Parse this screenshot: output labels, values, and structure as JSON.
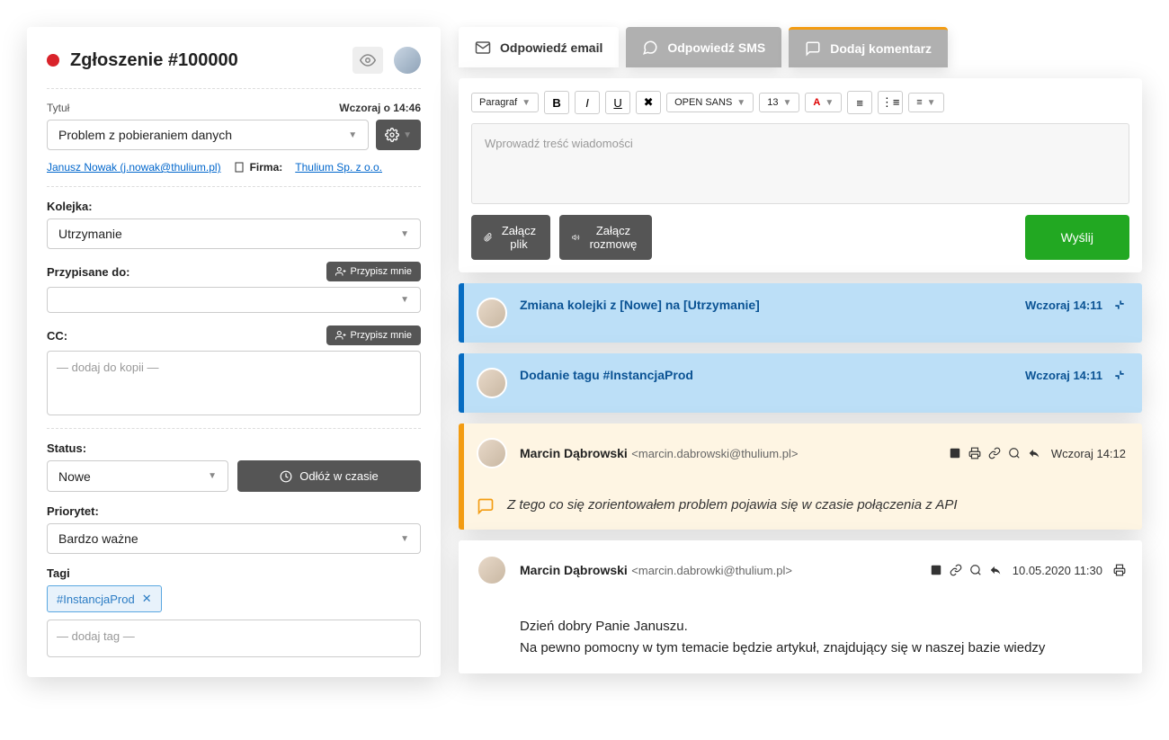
{
  "ticket": {
    "heading": "Zgłoszenie #100000",
    "title_label": "Tytuł",
    "timestamp": "Wczoraj o 14:46",
    "title_value": "Problem z pobieraniem danych",
    "contact_name": "Janusz Nowak (j.nowak@thulium.pl)",
    "company_label": "Firma:",
    "company_value": "Thulium Sp. z o.o.",
    "queue_label": "Kolejka:",
    "queue_value": "Utrzymanie",
    "assigned_label": "Przypisane do:",
    "assign_me": "Przypisz mnie",
    "cc_label": "CC:",
    "cc_placeholder": "— dodaj do kopii —",
    "status_label": "Status:",
    "status_value": "Nowe",
    "postpone": "Odłóż w czasie",
    "priority_label": "Priorytet:",
    "priority_value": "Bardzo ważne",
    "tags_label": "Tagi",
    "tag_value": "#InstancjaProd",
    "tag_placeholder": "— dodaj tag —"
  },
  "tabs": {
    "email": "Odpowiedź email",
    "sms": "Odpowiedź SMS",
    "comment": "Dodaj komentarz"
  },
  "editor": {
    "para": "Paragraf",
    "font": "OPEN SANS",
    "size": "13",
    "placeholder": "Wprowadź treść wiadomości",
    "attach_file": "Załącz plik",
    "attach_call": "Załącz rozmowę",
    "send": "Wyślij"
  },
  "timeline": [
    {
      "title": "Zmiana kolejki z [Nowe] na [Utrzymanie]",
      "time": "Wczoraj 14:11"
    },
    {
      "title": "Dodanie tagu #InstancjaProd",
      "time": "Wczoraj 14:11"
    },
    {
      "author_name": "Marcin Dąbrowski",
      "author_email": "<marcin.dabrowski@thulium.pl>",
      "time": "Wczoraj 14:12",
      "body": "Z tego co się zorientowałem problem pojawia się w czasie połączenia z API"
    },
    {
      "author_name": "Marcin Dąbrowski",
      "author_email": "<marcin.dabrowki@thulium.pl>",
      "time": "10.05.2020 11:30",
      "body_line1": "Dzień dobry Panie Januszu.",
      "body_line2": "Na pewno pomocny w tym temacie będzie artykuł, znajdujący się w naszej bazie wiedzy"
    }
  ]
}
